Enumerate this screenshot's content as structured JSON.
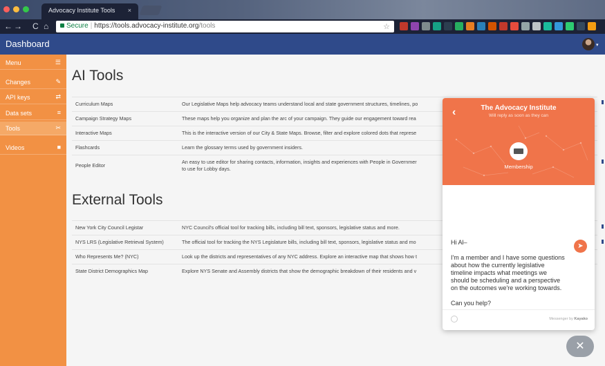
{
  "browser": {
    "tab_title": "Advocacy Institute Tools",
    "tab_close": "×",
    "url_secure": "Secure",
    "url_divider": "|",
    "url_base": "https://tools.advocacy-institute.org",
    "url_path": "/tools",
    "back_glyph": "←",
    "forward_glyph": "→",
    "reload_glyph": "C",
    "home_glyph": "⌂",
    "bookmark_glyph": "☆",
    "extension_colors": [
      "#c0392b",
      "#8e44ad",
      "#7f8c8d",
      "#16a085",
      "#2c3e50",
      "#27ae60",
      "#e67e22",
      "#2980b9",
      "#d35400",
      "#c0392b",
      "#e74c3c",
      "#95a5a6",
      "#bdc3c7",
      "#1abc9c",
      "#3498db",
      "#2ecc71",
      "#34495e",
      "#f39c12"
    ]
  },
  "header": {
    "title": "Dashboard",
    "avatar_caret": "▾"
  },
  "sidebar": {
    "items": [
      {
        "label": "Menu",
        "icon": "☰"
      },
      {
        "label": "Changes",
        "icon": "✎"
      },
      {
        "label": "API keys",
        "icon": "⇄"
      },
      {
        "label": "Data sets",
        "icon": "≡"
      },
      {
        "label": "Tools",
        "icon": "✂"
      },
      {
        "label": "Videos",
        "icon": "■"
      }
    ],
    "active_index": 4
  },
  "ai_tools": {
    "heading": "AI Tools",
    "rows": [
      {
        "name": "Curriculum Maps",
        "desc": "Our Legislative Maps help advocacy teams understand local and state government structures, timelines, po"
      },
      {
        "name": "Campaign Strategy Maps",
        "desc": "These maps help you organize and plan the arc of your campaign. They guide our engagement toward rea"
      },
      {
        "name": "Interactive Maps",
        "desc": "This is the interactive version of our City & State Maps. Browse, filter and explore colored dots that represe"
      },
      {
        "name": "Flashcards",
        "desc": "Learn the glossary terms used by government insiders."
      },
      {
        "name": "People Editor",
        "desc": "An easy to use editor for sharing contacts, information, insights and experiences with People in Governmer",
        "desc2": "to use for Lobby days."
      }
    ]
  },
  "external_tools": {
    "heading": "External Tools",
    "rows": [
      {
        "name": "New York City Council Legistar",
        "desc": "NYC Council's official tool for tracking bills, including bill text, sponsors, legislative status and more."
      },
      {
        "name": "NYS LRS (Legislative Retrieval System)",
        "desc": "The official tool for tracking the NYS Legislature bills, including bill text, sponsors, legislative status and mo"
      },
      {
        "name": "Who Represents Me? (NYC)",
        "desc": "Look up the districts and representatives of any NYC address. Explore an interactive map that shows how t"
      },
      {
        "name": "State District Demographics Map",
        "desc": "Explore NYS Senate and Assembly districts that show the demographic breakdown of their residents and v"
      }
    ]
  },
  "messenger": {
    "back_glyph": "‹",
    "title": "The Advocacy Institute",
    "subtitle": "Will reply as soon as they can",
    "team_label": "Membership",
    "message_lines": [
      "Hi Al–",
      "I'm a member and I have some questions about how the currently legislative timeline impacts what meetings we should be scheduling and a perspective  on the outcomes we're working towards.",
      "Can you help?"
    ],
    "send_glyph": "➤",
    "powered_prefix": "Messenger by ",
    "powered_brand": "Kayako",
    "close_glyph": "✕",
    "accent": "#f0744a"
  },
  "colors": {
    "header_bg": "#2f4a8a",
    "sidebar_bg": "#f29144",
    "content_bg": "#f5f5f5"
  }
}
